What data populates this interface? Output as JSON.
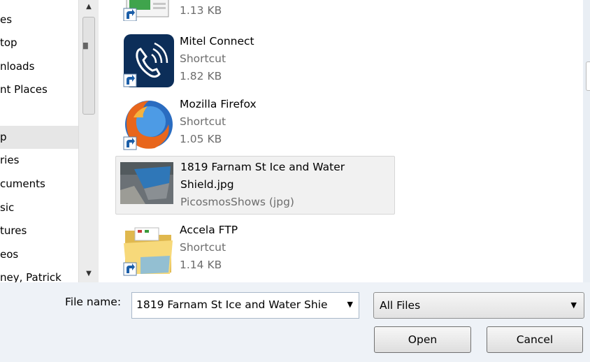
{
  "sidebar": {
    "items": [
      {
        "label": "es"
      },
      {
        "label": "top"
      },
      {
        "label": "nloads"
      },
      {
        "label": "nt Places"
      },
      {
        "label": ""
      },
      {
        "label": "p"
      },
      {
        "label": "ries"
      },
      {
        "label": "cuments"
      },
      {
        "label": "sic"
      },
      {
        "label": "tures"
      },
      {
        "label": "eos"
      },
      {
        "label": "ney, Patrick"
      }
    ]
  },
  "files": [
    {
      "name": "",
      "type": "",
      "size": "1.13 KB",
      "icon": "partial-shortcut-icon"
    },
    {
      "name": "Mitel Connect",
      "type": "Shortcut",
      "size": "1.82 KB",
      "icon": "mitel-connect-icon"
    },
    {
      "name": "Mozilla Firefox",
      "type": "Shortcut",
      "size": "1.05 KB",
      "icon": "firefox-icon"
    },
    {
      "name": "1819 Farnam St Ice and Water Shield.jpg",
      "type": "PicosmosShows (jpg)",
      "size": "",
      "icon": "image-thumbnail-icon"
    },
    {
      "name": "Accela FTP",
      "type": "Shortcut",
      "size": "1.14 KB",
      "icon": "folder-icon"
    }
  ],
  "footer": {
    "file_name_label": "File name:",
    "file_name_value": "1819 Farnam St Ice and Water Shie",
    "file_type_value": "All Files",
    "open_label": "Open",
    "cancel_label": "Cancel"
  }
}
